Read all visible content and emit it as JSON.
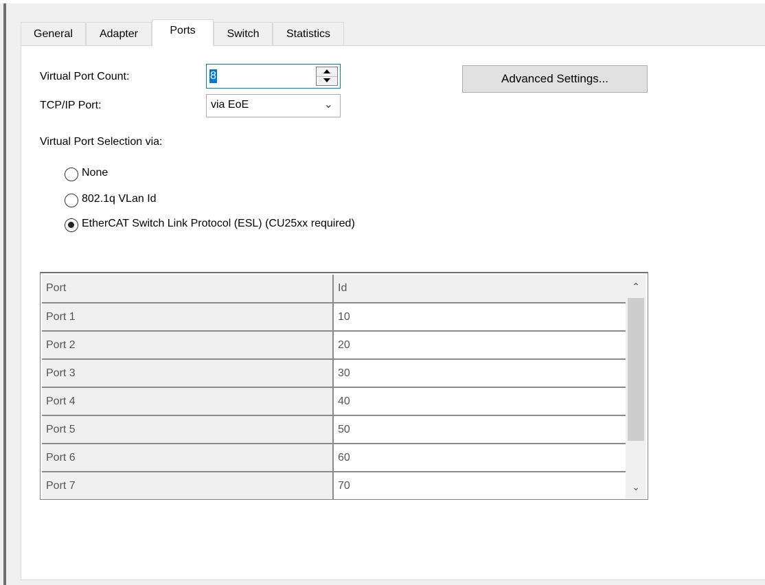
{
  "tabs": [
    {
      "label": "General"
    },
    {
      "label": "Adapter"
    },
    {
      "label": "Ports"
    },
    {
      "label": "Switch"
    },
    {
      "label": "Statistics"
    }
  ],
  "active_tab": "Ports",
  "form": {
    "virtual_port_count_label": "Virtual Port Count:",
    "virtual_port_count_value": "8",
    "tcpip_port_label": "TCP/IP Port:",
    "tcpip_port_value": "via EoE",
    "advanced_button": "Advanced Settings...",
    "selection_label": "Virtual Port Selection via:"
  },
  "radios": [
    {
      "label": "None",
      "checked": false
    },
    {
      "label": "802.1q VLan Id",
      "checked": false
    },
    {
      "label": "EtherCAT Switch Link Protocol (ESL) (CU25xx required)",
      "checked": true
    }
  ],
  "grid": {
    "headers": [
      "Port",
      "Id"
    ],
    "rows": [
      [
        "Port 1",
        "10"
      ],
      [
        "Port 2",
        "20"
      ],
      [
        "Port 3",
        "30"
      ],
      [
        "Port 4",
        "40"
      ],
      [
        "Port 5",
        "50"
      ],
      [
        "Port 6",
        "60"
      ],
      [
        "Port 7",
        "70"
      ]
    ]
  },
  "icons": {
    "spin_up": "triangle-up-icon",
    "spin_down": "triangle-down-icon",
    "combo_arrow": "chevron-down-icon",
    "scroll_up": "chevron-up-icon",
    "scroll_down": "chevron-down-icon"
  }
}
